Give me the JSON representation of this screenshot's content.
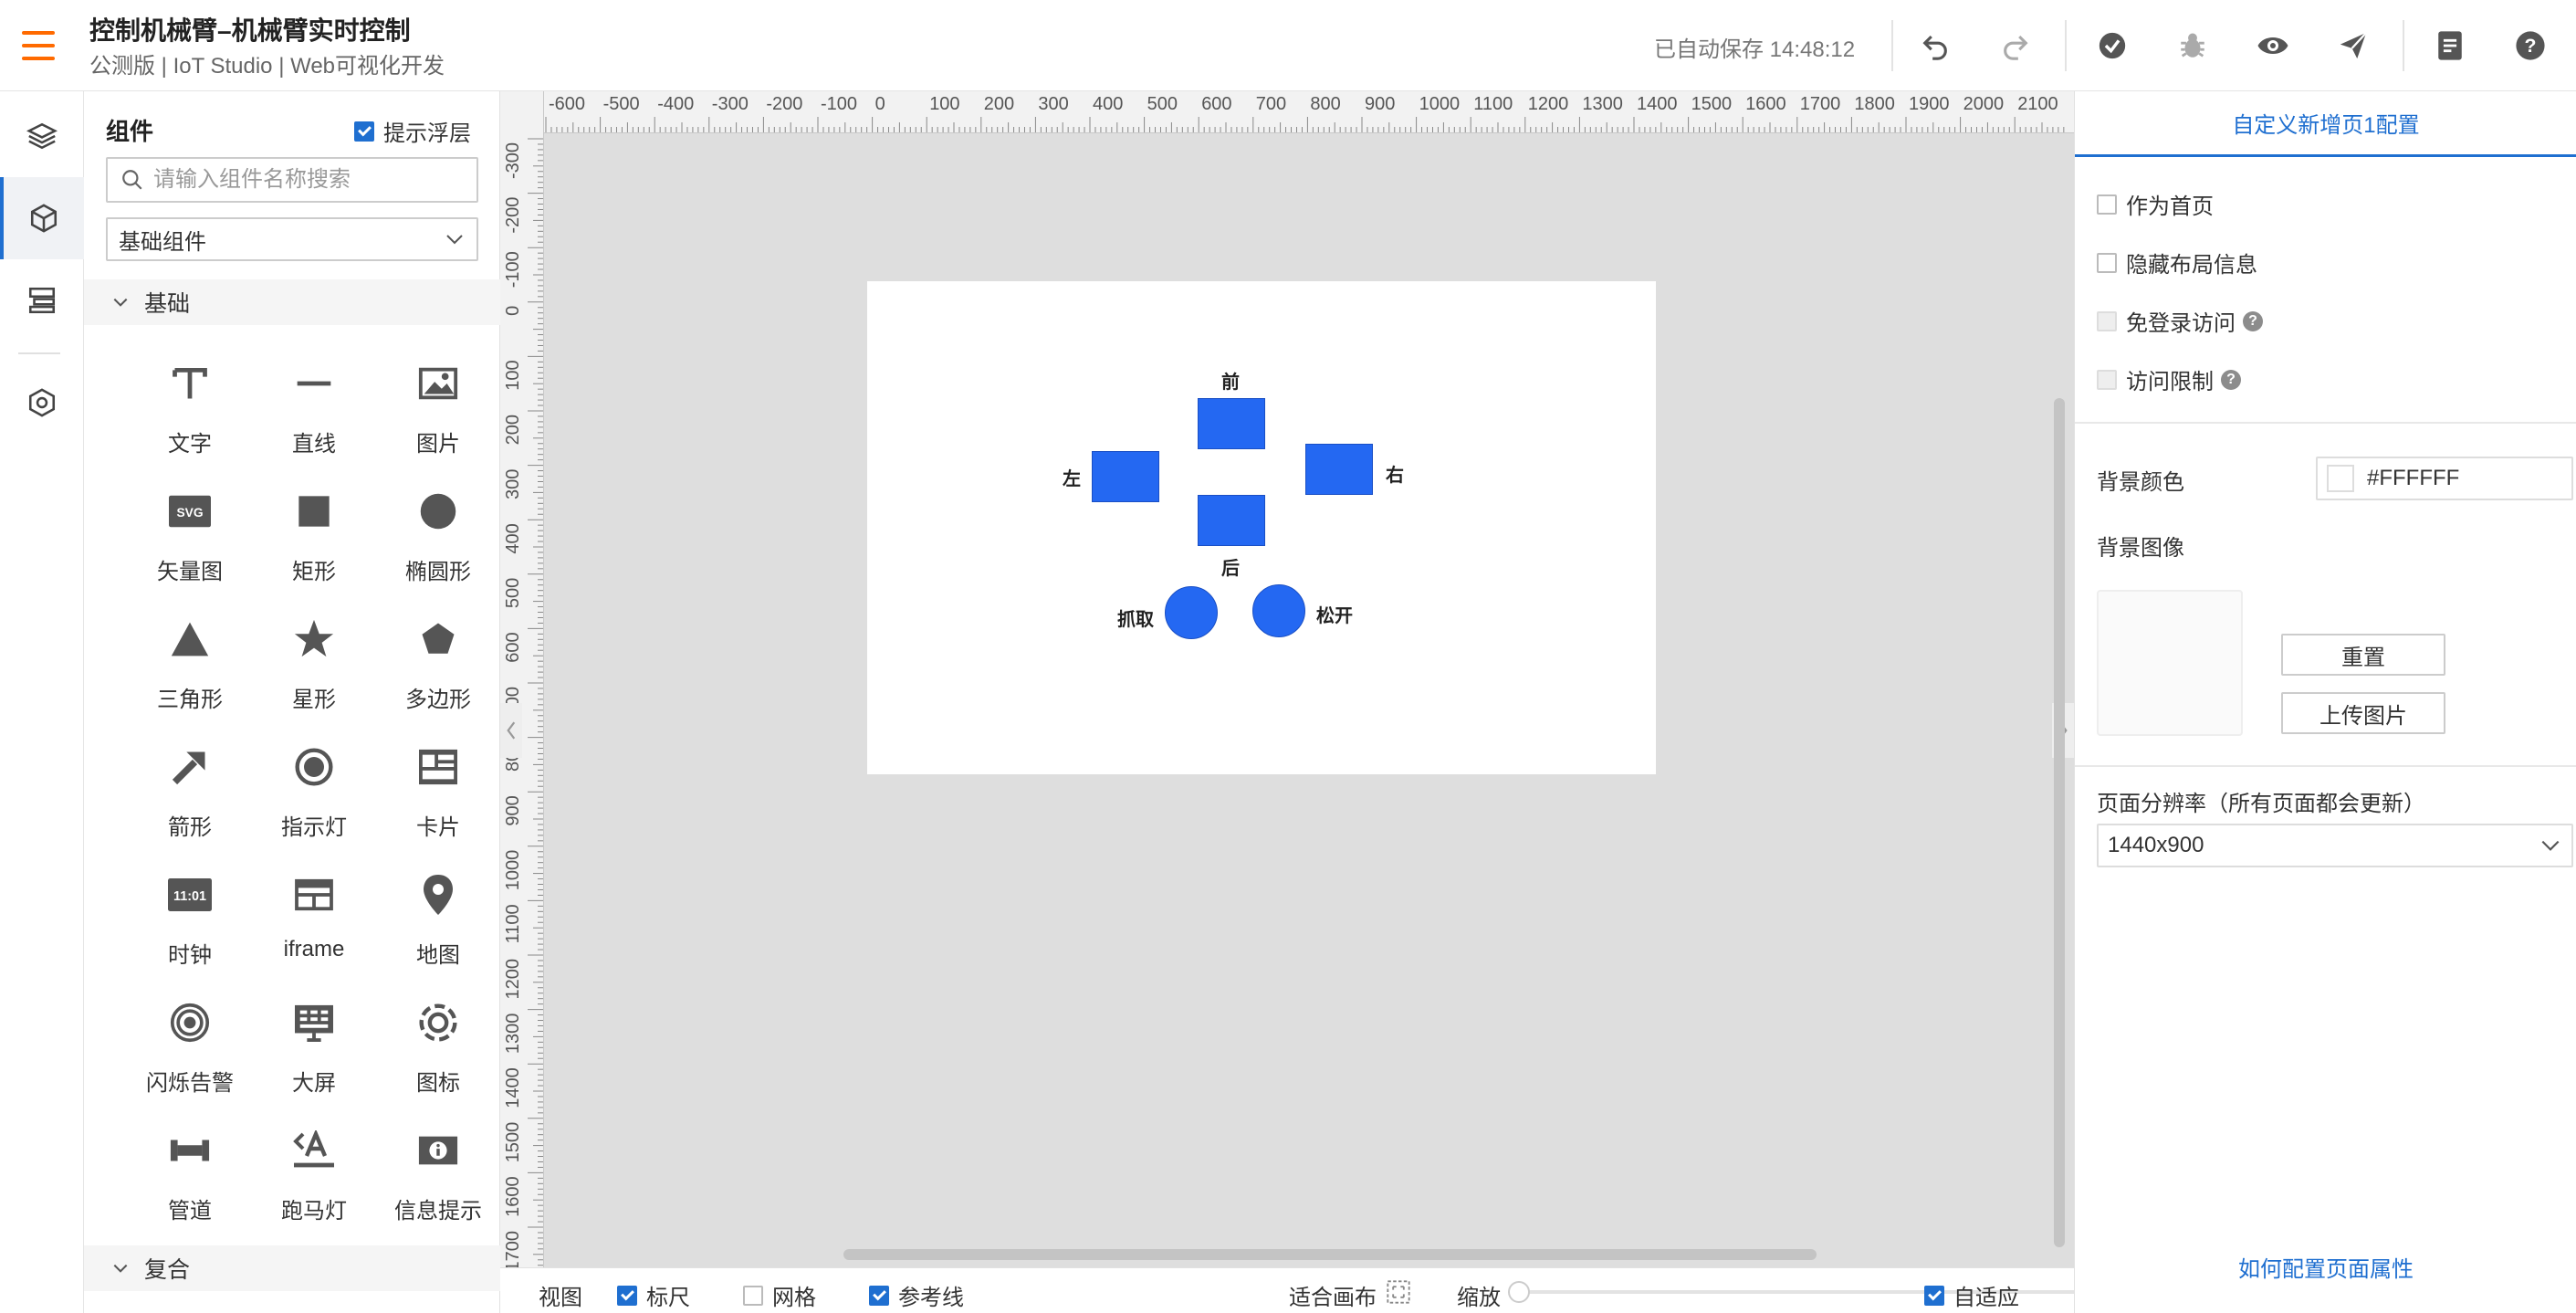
{
  "header": {
    "title": "控制机械臂–机械臂实时控制",
    "subtitle": "公测版 | IoT Studio | Web可视化开发",
    "autosave": "已自动保存 14:48:12",
    "toolbar_icons": [
      "undo-icon",
      "redo-icon",
      "check-circle-icon",
      "bug-icon",
      "eye-icon",
      "send-icon",
      "doc-icon",
      "help-icon"
    ]
  },
  "leftnav": {
    "items": [
      "layers-icon",
      "box-icon",
      "layout-icon",
      "settings-icon"
    ],
    "active_index": 1
  },
  "components": {
    "title": "组件",
    "hint_toggle": "提示浮层",
    "hint_checked": true,
    "search_placeholder": "请输入组件名称搜索",
    "category": "基础组件",
    "group_basic": "基础",
    "group_composite": "复合",
    "items": [
      {
        "label": "文字",
        "icon": "text-icon"
      },
      {
        "label": "直线",
        "icon": "line-icon"
      },
      {
        "label": "图片",
        "icon": "image-icon"
      },
      {
        "label": "矢量图",
        "icon": "svg-icon",
        "icon_text": "SVG"
      },
      {
        "label": "矩形",
        "icon": "rect-icon"
      },
      {
        "label": "椭圆形",
        "icon": "ellipse-icon"
      },
      {
        "label": "三角形",
        "icon": "triangle-icon"
      },
      {
        "label": "星形",
        "icon": "star-icon"
      },
      {
        "label": "多边形",
        "icon": "polygon-icon"
      },
      {
        "label": "箭形",
        "icon": "arrow-icon"
      },
      {
        "label": "指示灯",
        "icon": "indicator-icon"
      },
      {
        "label": "卡片",
        "icon": "card-icon"
      },
      {
        "label": "时钟",
        "icon": "clock-icon",
        "icon_text": "11:01"
      },
      {
        "label": "iframe",
        "icon": "iframe-icon"
      },
      {
        "label": "地图",
        "icon": "map-pin-icon"
      },
      {
        "label": "闪烁告警",
        "icon": "alarm-icon"
      },
      {
        "label": "大屏",
        "icon": "dashboard-icon"
      },
      {
        "label": "图标",
        "icon": "icon-icon"
      },
      {
        "label": "管道",
        "icon": "pipe-icon"
      },
      {
        "label": "跑马灯",
        "icon": "marquee-icon"
      },
      {
        "label": "信息提示",
        "icon": "info-icon"
      }
    ]
  },
  "rulers": {
    "h_ticks": [
      "-600",
      "-500",
      "-400",
      "-300",
      "-200",
      "-100",
      "0",
      "100",
      "200",
      "300",
      "400",
      "500",
      "600",
      "700",
      "800",
      "900",
      "1000",
      "1100",
      "1200",
      "1300",
      "1400",
      "1500",
      "1600",
      "1700",
      "1800",
      "1900",
      "2000",
      "2100"
    ],
    "v_ticks": [
      "-300",
      "-200",
      "-100",
      "0",
      "100",
      "200",
      "300",
      "400",
      "500",
      "600",
      "700",
      "800",
      "900",
      "1000",
      "1100",
      "1200",
      "1300",
      "1400",
      "1500",
      "1600",
      "1700"
    ]
  },
  "canvas": {
    "labels": {
      "front": "前",
      "back": "后",
      "left": "左",
      "right": "右",
      "grab": "抓取",
      "release": "松开"
    },
    "widget_color": "#2468f2"
  },
  "bottombar": {
    "view": "视图",
    "ruler": "标尺",
    "ruler_checked": true,
    "grid": "网格",
    "grid_checked": false,
    "guides": "参考线",
    "guides_checked": true,
    "fit": "适合画布",
    "zoom": "缩放",
    "adaptive": "自适应",
    "adaptive_checked": true
  },
  "config": {
    "title": "自定义新增页1配置",
    "as_home": "作为首页",
    "hide_layout": "隐藏布局信息",
    "no_login": "免登录访问",
    "access_limit": "访问限制",
    "bg_color_label": "背景颜色",
    "bg_color": "#FFFFFF",
    "bg_image_label": "背景图像",
    "reset": "重置",
    "upload": "上传图片",
    "resolution_label": "页面分辨率（所有页面都会更新）",
    "resolution": "1440x900",
    "help_link": "如何配置页面属性",
    "accent": "#1f6fd0"
  }
}
